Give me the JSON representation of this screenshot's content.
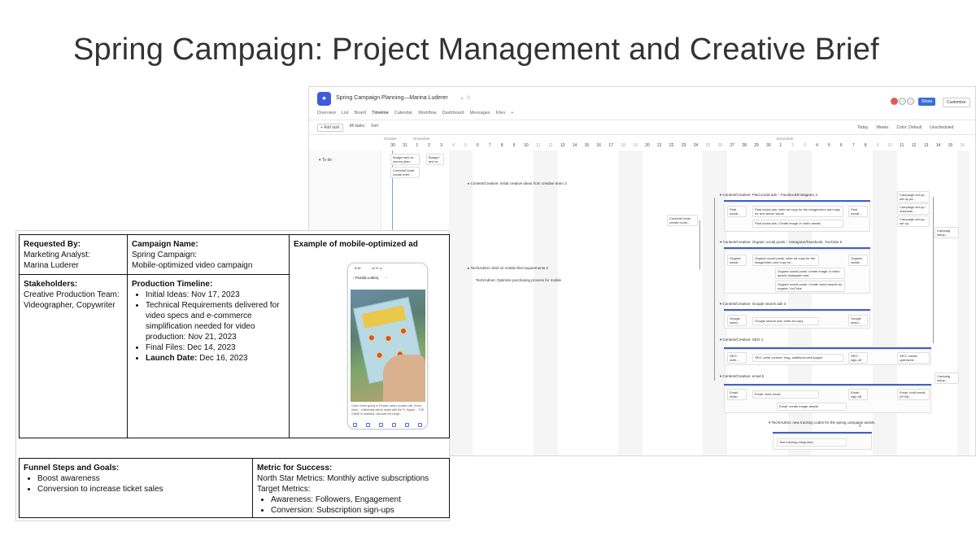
{
  "slide": {
    "title": "Spring Campaign: Project Management and Creative Brief"
  },
  "app": {
    "title": "Spring Campaign Planning—Marina Luderer",
    "title_controls": "⌄ ☆",
    "avatar_initials": "ML",
    "share_label": "Share",
    "customize_label": "Customize",
    "tabs": [
      "Overview",
      "List",
      "Board",
      "Timeline",
      "Calendar",
      "Workflow",
      "Dashboard",
      "Messages",
      "Files",
      "+"
    ],
    "active_tab": "Timeline",
    "toolbar": {
      "add_task": "+ Add task",
      "all_tasks": "All tasks",
      "sort": "Sort",
      "today": "Today",
      "weeks": "Weeks",
      "color": "Color: Default",
      "unscheduled": "Unscheduled"
    },
    "months": [
      "October",
      "November",
      "December"
    ],
    "days": [
      "30",
      "31",
      "1",
      "2",
      "3",
      "4",
      "5",
      "6",
      "7",
      "8",
      "9",
      "10",
      "11",
      "12",
      "13",
      "14",
      "15",
      "16",
      "17",
      "18",
      "19",
      "20",
      "21",
      "22",
      "23",
      "24",
      "25",
      "26",
      "27",
      "28",
      "29",
      "30",
      "1",
      "2",
      "3",
      "4",
      "5",
      "6",
      "7",
      "8",
      "9",
      "10",
      "11",
      "12",
      "13",
      "14",
      "15",
      "16"
    ],
    "section": "To do",
    "groups": [
      "Content/Creative: Initial creative ideas from creative team 3",
      "Tech/Admin: brief on mobile-first requirements 2",
      "Tech/Admin: Optimize purchasing process for mobile",
      "Content/Creative: Paid social ads – Facebook/Instagram 4",
      "Content/Creative: Organic social posts – Instagram/Facebook, YouTube 6",
      "Content/Creative: Google search ads 3",
      "Content/Creative: SEO 4",
      "Content/Creative: email 5",
      "Tech/Admin: new tracking codes for the spring campaign assets",
      "1"
    ],
    "cards": {
      "budget1": "Budget and re-source plan...",
      "budget2": "Budget and re...",
      "creative_brief": "Content/Creati create brief...",
      "creative_cont": "Content/Creati create conte...",
      "paid_a": "Paid social...",
      "paid_b": "Paid social ads: write ad copy for the image/video and copy for text above visual",
      "paid_c": "Paid social...",
      "paid_d": "Paid social ads: Create image or video assets",
      "org_a": "Organic social...",
      "org_b": "Organic social posts: write ad copy for the image/video and copy for...",
      "org_c": "Organic social...",
      "org_d": "Organic social posts: create image or video assets Instagram and...",
      "org_e": "Organic social posts: Create video assets for organic YouTube",
      "gs_a": "Google searc...",
      "gs_b": "Google search ads: write ad copy",
      "gs_c": "Google searc...",
      "seo_a": "SEO: write...",
      "seo_b": "SEO: write content: blog, additional web pages",
      "seo_c": "SEO: sign-off",
      "seo_d": "SEO: create optimized...",
      "em_a": "Email: Write...",
      "em_b": "Email: write email",
      "em_c": "Email: sign-off",
      "em_d": "Email: build email (HTML...",
      "em_e": "Email: create image assets",
      "track": "Test tracking integration",
      "setup1": "Campaign set-up: set up pa...",
      "setup2": "Campaign set-up: schedule...",
      "setup3": "Campaign set-up: set up...",
      "setup4": "Campaig setup:...",
      "setup5": "Campaig setup:..."
    }
  },
  "brief": {
    "requested_by_label": "Requested By:",
    "requested_by_role": "Marketing Analyst:",
    "requested_by_name": "Marina Luderer",
    "campaign_name_label": "Campaign Name:",
    "campaign_name_1": "Spring Campaign:",
    "campaign_name_2": "Mobile-optimized video campaign",
    "example_label": "Example of mobile-optimized ad",
    "stakeholders_label": "Stakeholders:",
    "stakeholders_1": "Creative Production Team:",
    "stakeholders_2": "Videographer, Copywriter",
    "timeline_label": "Production Timeline:",
    "timeline": [
      "Initial Ideas: Nov 17, 2023",
      "Technical Requirements delivered for video specs and e-commerce simplification needed for video production: Nov 21, 2023",
      "Final Files: Dec 14, 2023"
    ],
    "launch_label": "Launch Date:",
    "launch_value": " Dec 16, 2023",
    "funnel_label": "Funnel Steps and Goals:",
    "funnel": [
      "Boost awareness",
      "Conversion to increase ticket sales"
    ],
    "metric_label": "Metric for Success:",
    "north_star": "North Star Metrics: Monthly active subscriptions",
    "target_label": "Target Metrics:",
    "targets": [
      "Awareness: Followers, Engagement",
      "Conversion: Subscription sign-ups"
    ]
  },
  "phone": {
    "status_time": "9:41",
    "status_icons": "•ıl ᯤ ▭",
    "account": "Florida Lottery",
    "caption": "Catch some spring in Florida Lottery scratch-offs. Every ticket... millennials will be ready with the FL Digital ... THE GAME is available, discover the range..."
  }
}
